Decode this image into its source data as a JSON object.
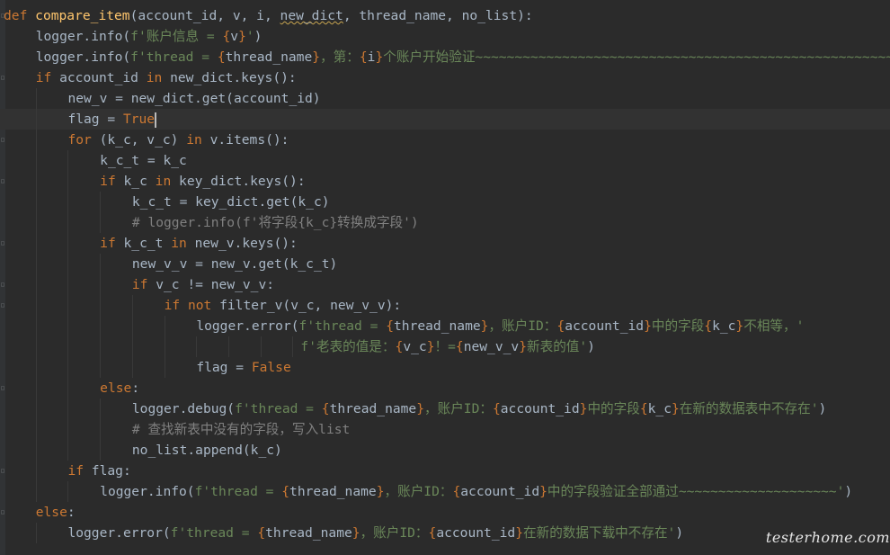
{
  "code_lines": [
    {
      "indent": 0,
      "text": "def compare_item(account_id, v, i, new_dict, thread_name, no_list):"
    },
    {
      "indent": 4,
      "text": "logger.info(f'账户信息 = {v}')"
    },
    {
      "indent": 4,
      "text": "logger.info(f'thread = {thread_name}，第：{i}个账户开始验证~~~~~~~~~~~~~~~~~~~~~~~~~~~~~~~~~~~~~~~~~~~~~~~~~~~~~~')"
    },
    {
      "indent": 4,
      "text": "if account_id in new_dict.keys():"
    },
    {
      "indent": 8,
      "text": "new_v = new_dict.get(account_id)"
    },
    {
      "indent": 8,
      "text": "flag = True"
    },
    {
      "indent": 8,
      "text": "for (k_c, v_c) in v.items():"
    },
    {
      "indent": 12,
      "text": "k_c_t = k_c"
    },
    {
      "indent": 12,
      "text": "if k_c in key_dict.keys():"
    },
    {
      "indent": 16,
      "text": "k_c_t = key_dict.get(k_c)"
    },
    {
      "indent": 16,
      "text": "# logger.info(f'将字段{k_c}转换成字段')"
    },
    {
      "indent": 12,
      "text": "if k_c_t in new_v.keys():"
    },
    {
      "indent": 16,
      "text": "new_v_v = new_v.get(k_c_t)"
    },
    {
      "indent": 16,
      "text": "if v_c != new_v_v:"
    },
    {
      "indent": 20,
      "text": "if not filter_v(v_c, new_v_v):"
    },
    {
      "indent": 24,
      "text": "logger.error(f'thread = {thread_name}，账户ID：{account_id}中的字段{k_c}不相等，'"
    },
    {
      "indent": 37,
      "text": "f'老表的值是：{v_c}！={new_v_v}新表的值')"
    },
    {
      "indent": 24,
      "text": "flag = False"
    },
    {
      "indent": 12,
      "text": "else:"
    },
    {
      "indent": 16,
      "text": "logger.debug(f'thread = {thread_name}，账户ID：{account_id}中的字段{k_c}在新的数据表中不存在')"
    },
    {
      "indent": 16,
      "text": "# 查找新表中没有的字段，写入list"
    },
    {
      "indent": 16,
      "text": "no_list.append(k_c)"
    },
    {
      "indent": 8,
      "text": "if flag:"
    },
    {
      "indent": 12,
      "text": "logger.info(f'thread = {thread_name}，账户ID：{account_id}中的字段验证全部通过~~~~~~~~~~~~~~~~~~~~')"
    },
    {
      "indent": 4,
      "text": "else:"
    },
    {
      "indent": 8,
      "text": "logger.error(f'thread = {thread_name}，账户ID：{account_id}在新的数据下载中不存在')"
    }
  ],
  "watermark": "testerhome.com",
  "colors": {
    "background": "#2b2b2b",
    "keyword": "#cc7832",
    "function_name": "#ffc66d",
    "string": "#6a8759",
    "comment": "#808080",
    "text": "#a9b7c6"
  }
}
